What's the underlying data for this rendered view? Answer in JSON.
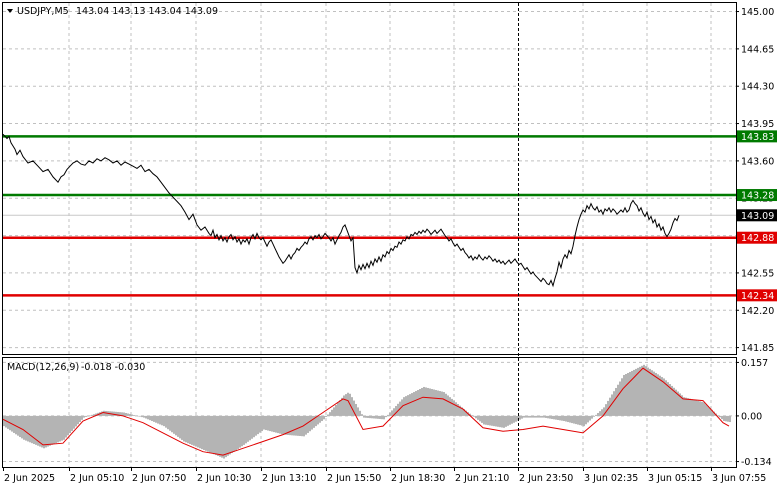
{
  "header": {
    "symbol_label": "USDJPY,M5",
    "ohlc_label": "143.04 143.13 143.04 143.09",
    "menu_icon": "triangle-down-icon"
  },
  "macd_header": {
    "label": "MACD(12,26,9)",
    "values_label": "-0.018 -0.030"
  },
  "colors": {
    "price_line": "#000000",
    "resistance": "#007a00",
    "support": "#e00000",
    "current_price_box": "#000000",
    "macd_hist": "#b4b4b4",
    "macd_signal": "#e00000",
    "grid": "#c0c0c0"
  },
  "chart_data": [
    {
      "type": "line",
      "name": "USDJPY M5 price",
      "ylim": [
        141.79,
        145.08
      ],
      "y_ticks": [
        "145.00",
        "144.65",
        "144.30",
        "143.95",
        "143.60",
        "143.25",
        "142.90",
        "142.55",
        "142.20",
        "141.85"
      ],
      "x_ticks": [
        "2 Jun 2025",
        "2 Jun 05:10",
        "2 Jun 07:50",
        "2 Jun 10:30",
        "2 Jun 13:10",
        "2 Jun 15:50",
        "2 Jun 18:30",
        "2 Jun 21:10",
        "2 Jun 23:50",
        "3 Jun 02:35",
        "3 Jun 05:15",
        "3 Jun 07:55"
      ],
      "grid": true,
      "vertical_marker_at": "2 Jun 23:50",
      "current_price": 143.09,
      "current_price_label": "143.09",
      "levels": [
        {
          "value": 143.83,
          "label": "143.83",
          "kind": "resistance"
        },
        {
          "value": 143.28,
          "label": "143.28",
          "kind": "resistance"
        },
        {
          "value": 142.88,
          "label": "142.88",
          "kind": "support"
        },
        {
          "value": 142.34,
          "label": "142.34",
          "kind": "support"
        }
      ],
      "x": [
        0,
        2,
        4,
        6,
        8,
        10,
        12,
        14,
        17,
        20,
        25,
        30,
        35,
        40,
        45,
        50,
        55,
        58,
        61,
        64,
        67,
        70,
        74,
        78,
        82,
        86,
        90,
        94,
        98,
        102,
        106,
        110,
        114,
        118,
        122,
        126,
        130,
        134,
        138,
        142,
        146,
        150,
        154,
        158,
        162,
        166,
        170,
        174,
        178,
        182,
        186,
        190,
        194,
        198,
        202,
        206,
        208,
        210,
        212,
        214,
        216,
        218,
        220,
        222,
        224,
        226,
        228,
        230,
        232,
        234,
        236,
        238,
        240,
        242,
        244,
        246,
        248,
        250,
        252,
        254,
        256,
        258,
        260,
        262,
        264,
        266,
        268,
        270,
        272,
        274,
        276,
        278,
        280,
        282,
        284,
        286,
        288,
        290,
        292,
        294,
        296,
        298,
        300,
        302,
        304,
        306,
        308,
        310,
        312,
        314,
        316,
        318,
        320,
        322,
        324,
        326,
        328,
        330,
        332,
        334,
        336,
        338,
        340,
        342,
        344,
        346,
        348,
        350,
        352,
        354,
        356,
        358,
        360,
        362,
        364,
        366,
        368,
        370,
        372,
        374,
        376,
        378,
        380,
        382,
        384,
        386,
        388,
        390,
        392,
        394,
        396,
        398,
        400,
        402,
        404,
        406,
        408,
        410,
        412,
        414,
        416,
        418,
        420,
        422,
        424,
        426,
        428,
        430,
        432,
        434,
        436,
        438,
        440,
        442,
        444,
        446,
        448,
        450,
        452,
        454,
        456,
        458,
        460,
        462,
        464,
        466,
        468,
        470,
        472,
        474,
        476,
        478,
        480,
        482,
        484,
        486,
        488,
        490,
        492,
        494,
        496,
        498,
        500,
        502,
        504,
        506,
        508,
        510,
        512,
        514,
        516,
        518,
        520,
        522,
        524,
        526,
        528,
        530,
        532,
        534,
        536,
        538,
        540,
        542,
        544,
        546,
        548,
        550,
        552,
        554,
        556,
        558,
        560,
        562,
        564,
        566,
        568,
        570,
        572,
        574,
        576,
        578,
        580,
        582,
        584,
        586,
        588,
        590,
        592,
        594,
        596,
        598,
        600,
        602,
        604,
        606,
        608,
        610,
        612,
        614,
        616,
        618,
        620,
        622,
        624,
        626,
        628,
        630,
        632,
        634,
        636,
        638,
        640,
        642,
        644,
        646,
        648,
        650,
        652,
        654,
        656,
        658,
        660,
        662,
        664,
        666,
        668,
        670,
        672,
        674,
        676,
        678,
        680,
        682,
        684,
        686,
        688,
        690,
        692,
        694,
        696,
        698,
        700,
        702,
        704,
        706,
        708,
        710,
        712,
        714,
        716,
        718,
        720,
        722,
        724,
        726
      ],
      "y": [
        143.85,
        143.83,
        143.81,
        143.83,
        143.77,
        143.74,
        143.71,
        143.66,
        143.7,
        143.64,
        143.58,
        143.6,
        143.55,
        143.5,
        143.52,
        143.45,
        143.4,
        143.45,
        143.47,
        143.52,
        143.55,
        143.58,
        143.6,
        143.57,
        143.56,
        143.6,
        143.58,
        143.62,
        143.6,
        143.63,
        143.61,
        143.58,
        143.6,
        143.56,
        143.59,
        143.57,
        143.55,
        143.53,
        143.56,
        143.5,
        143.52,
        143.48,
        143.45,
        143.4,
        143.35,
        143.3,
        143.26,
        143.22,
        143.18,
        143.12,
        143.05,
        143.1,
        143.0,
        142.95,
        142.98,
        142.92,
        142.9,
        142.95,
        142.88,
        142.91,
        142.86,
        142.9,
        142.85,
        142.88,
        142.84,
        142.89,
        142.91,
        142.86,
        142.89,
        142.84,
        142.87,
        142.82,
        142.86,
        142.84,
        142.87,
        142.82,
        142.88,
        142.91,
        142.87,
        142.92,
        142.88,
        142.86,
        142.88,
        142.84,
        142.8,
        142.84,
        142.86,
        142.82,
        142.78,
        142.74,
        142.7,
        142.67,
        142.64,
        142.66,
        142.69,
        142.72,
        142.68,
        142.72,
        142.74,
        142.78,
        142.76,
        142.79,
        142.81,
        142.84,
        142.82,
        142.87,
        142.89,
        142.86,
        142.9,
        142.88,
        142.91,
        142.87,
        142.89,
        142.92,
        142.9,
        142.88,
        142.85,
        142.88,
        142.82,
        142.86,
        142.9,
        142.93,
        142.98,
        143.0,
        142.95,
        142.9,
        142.85,
        142.88,
        142.6,
        142.55,
        142.62,
        142.58,
        142.63,
        142.59,
        142.64,
        142.6,
        142.66,
        142.62,
        142.68,
        142.65,
        142.7,
        142.66,
        142.72,
        142.7,
        142.75,
        142.73,
        142.78,
        142.76,
        142.8,
        142.79,
        142.84,
        142.82,
        142.86,
        142.85,
        142.89,
        142.87,
        142.91,
        142.9,
        142.93,
        142.91,
        142.94,
        142.92,
        142.95,
        142.93,
        142.96,
        142.94,
        142.91,
        142.93,
        142.95,
        142.92,
        142.94,
        142.96,
        142.93,
        142.9,
        142.88,
        142.85,
        142.87,
        142.83,
        142.8,
        142.82,
        142.79,
        142.76,
        142.78,
        142.74,
        142.72,
        142.69,
        142.71,
        142.67,
        142.7,
        142.68,
        142.72,
        142.69,
        142.67,
        142.7,
        142.68,
        142.71,
        142.69,
        142.66,
        142.68,
        142.65,
        142.67,
        142.64,
        142.66,
        142.63,
        142.65,
        142.67,
        142.64,
        142.66,
        142.68,
        142.65,
        142.63,
        142.64,
        142.61,
        142.58,
        142.6,
        142.57,
        142.54,
        142.56,
        142.53,
        142.51,
        142.49,
        142.47,
        142.5,
        142.48,
        142.45,
        142.44,
        142.48,
        142.43,
        142.5,
        142.56,
        142.65,
        142.6,
        142.68,
        142.72,
        142.69,
        142.76,
        142.73,
        142.8,
        142.9,
        142.98,
        143.05,
        143.1,
        143.14,
        143.12,
        143.18,
        143.15,
        143.2,
        143.16,
        143.14,
        143.17,
        143.12,
        143.14,
        143.1,
        143.15,
        143.13,
        143.16,
        143.12,
        143.15,
        143.13,
        143.1,
        143.12,
        143.14,
        143.12,
        143.16,
        143.12,
        143.14,
        143.2,
        143.23,
        143.2,
        143.18,
        143.13,
        143.16,
        143.11,
        143.08,
        143.12,
        143.05,
        143.08,
        143.02,
        143.05,
        142.98,
        143.01,
        142.95,
        142.98,
        142.92,
        142.89,
        142.92,
        142.96,
        143.02,
        143.06,
        143.04,
        143.09
      ]
    },
    {
      "type": "bar",
      "name": "MACD(12,26,9)",
      "ylim": [
        -0.15,
        0.17
      ],
      "y_ticks": [
        "0.157",
        "0.00",
        "-0.134"
      ],
      "grid": true,
      "signal_color": "#e00000",
      "hist_color": "#b4b4b4",
      "x": [
        0,
        20,
        40,
        60,
        80,
        100,
        120,
        140,
        160,
        180,
        200,
        220,
        240,
        260,
        280,
        300,
        320,
        340,
        345,
        360,
        380,
        400,
        420,
        440,
        460,
        480,
        500,
        520,
        540,
        560,
        580,
        600,
        620,
        640,
        660,
        680,
        700,
        720,
        726
      ],
      "histogram": [
        -0.03,
        -0.07,
        -0.095,
        -0.07,
        -0.005,
        0.015,
        0.01,
        -0.005,
        -0.03,
        -0.075,
        -0.1,
        -0.125,
        -0.085,
        -0.04,
        -0.055,
        -0.06,
        -0.01,
        0.06,
        0.07,
        -0.005,
        -0.01,
        0.055,
        0.085,
        0.07,
        0.02,
        -0.025,
        -0.035,
        -0.005,
        -0.005,
        -0.015,
        -0.03,
        0.025,
        0.12,
        0.15,
        0.11,
        0.055,
        0.04,
        -0.015,
        -0.018
      ],
      "signal": [
        -0.01,
        -0.04,
        -0.085,
        -0.08,
        -0.015,
        0.01,
        0.0,
        -0.02,
        -0.05,
        -0.08,
        -0.105,
        -0.115,
        -0.095,
        -0.075,
        -0.055,
        -0.03,
        0.01,
        0.05,
        0.045,
        -0.04,
        -0.03,
        0.03,
        0.055,
        0.05,
        0.02,
        -0.035,
        -0.045,
        -0.04,
        -0.03,
        -0.04,
        -0.05,
        0.0,
        0.08,
        0.14,
        0.1,
        0.05,
        0.045,
        -0.02,
        -0.03
      ]
    }
  ]
}
